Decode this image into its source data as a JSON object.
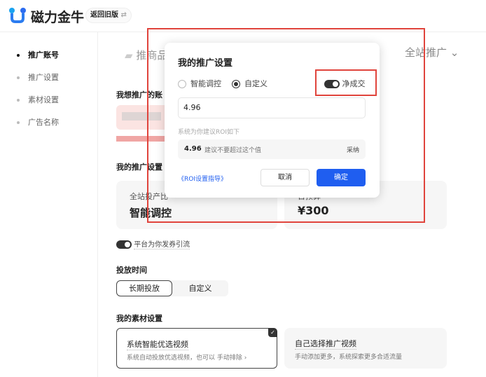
{
  "header": {
    "app_name": "磁力金牛",
    "back_button": "返回旧版",
    "swap_icon": "⇄"
  },
  "sidebar": {
    "items": [
      {
        "label": "推广账号",
        "active": true
      },
      {
        "label": "推广设置"
      },
      {
        "label": "素材设置"
      },
      {
        "label": "广告名称"
      }
    ]
  },
  "main": {
    "top_tab": "推商品",
    "scope_select": "全站推广",
    "account_heading": "我想推广的账",
    "settings_heading": "我的推广设置",
    "roi_card": {
      "label": "全站投产比",
      "value": "智能调控"
    },
    "budget_card": {
      "label": "日预算",
      "value": "¥300"
    },
    "coupon_toggle": "平台为你发券引流",
    "time_heading": "投放时间",
    "time_options": [
      "长期投放",
      "自定义"
    ],
    "material_heading": "我的素材设置",
    "material_cards": [
      {
        "title": "系统智能优选视频",
        "desc": "系统自动投放优选视频，也可以 手动排除 ›",
        "selected": true
      },
      {
        "title": "自己选择推广视频",
        "desc": "手动添加更多，系统探索更多合适流量",
        "selected": false
      }
    ]
  },
  "modal": {
    "title": "我的推广设置",
    "radio_options": [
      "智能调控",
      "自定义"
    ],
    "selected": "自定义",
    "net_toggle_label": "净成交",
    "roi_input": "4.96",
    "hint": "系统为你建议ROI如下",
    "suggest_value": "4.96",
    "suggest_text": "建议不要超过这个值",
    "adopt": "采纳",
    "guide_link": "《ROI设置指导》",
    "cancel": "取消",
    "confirm": "确定"
  },
  "colors": {
    "primary": "#1f5ef0",
    "highlight": "#e0443c"
  }
}
